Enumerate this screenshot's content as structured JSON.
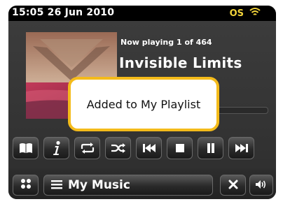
{
  "status_bar": {
    "time_date": "15:05 26 Jun 2010",
    "indicator_label": "OS",
    "wifi_icon": "wifi-icon",
    "indicator_color": "#f2d33a"
  },
  "now_playing": {
    "position_label": "Now playing 1 of 464",
    "track_title": "Invisible Limits",
    "progress": 0.22
  },
  "popup": {
    "message": "Added to My Playlist",
    "border_color": "#f4bb1a"
  },
  "controls": [
    {
      "name": "book-icon"
    },
    {
      "name": "info-icon"
    },
    {
      "name": "repeat-icon"
    },
    {
      "name": "shuffle-icon"
    },
    {
      "name": "previous-icon"
    },
    {
      "name": "stop-icon"
    },
    {
      "name": "pause-icon"
    },
    {
      "name": "next-icon"
    }
  ],
  "bottom_bar": {
    "menu_label": "My Music",
    "menu_icon": "hamburger-icon",
    "close_icon": "close-icon",
    "volume_icon": "volume-icon",
    "grid_icon": "grid-icon"
  }
}
